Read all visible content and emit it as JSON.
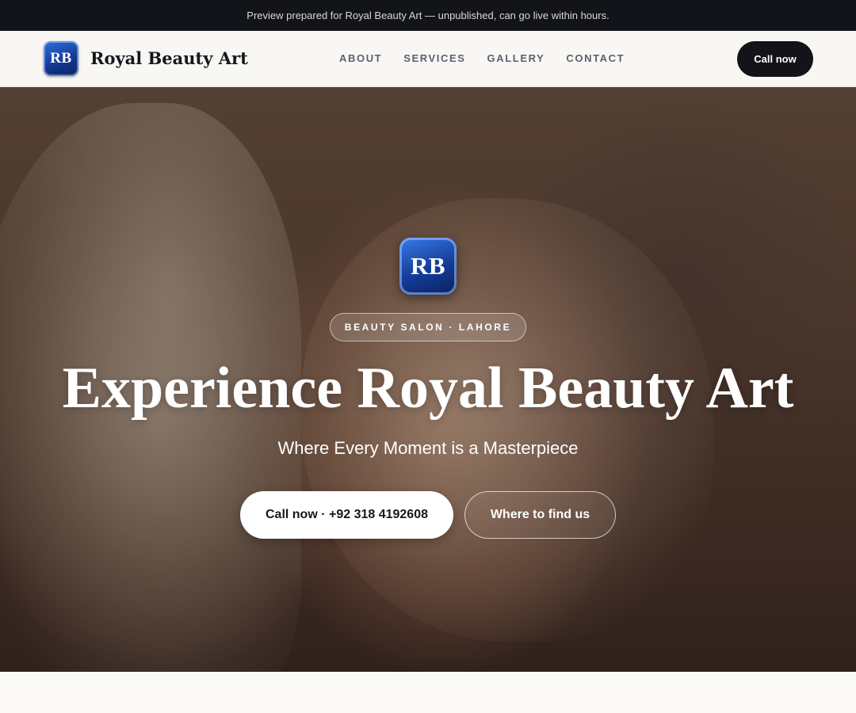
{
  "banner": {
    "text": "Preview prepared for Royal Beauty Art — unpublished, can go live within hours."
  },
  "header": {
    "logo_text": "RB",
    "brand_name": "Royal Beauty Art",
    "nav": [
      {
        "label": "ABOUT"
      },
      {
        "label": "SERVICES"
      },
      {
        "label": "GALLERY"
      },
      {
        "label": "CONTACT"
      }
    ],
    "cta_label": "Call now"
  },
  "hero": {
    "logo_text": "RB",
    "badge": "BEAUTY SALON · LAHORE",
    "title": "Experience Royal Beauty Art",
    "subtitle": "Where Every Moment is a Masterpiece",
    "primary_cta": "Call now · +92 318 4192608",
    "secondary_cta": "Where to find us"
  },
  "colors": {
    "dark": "#12141a",
    "logo_blue": "#143c98",
    "light_bg": "#faf9f6"
  }
}
